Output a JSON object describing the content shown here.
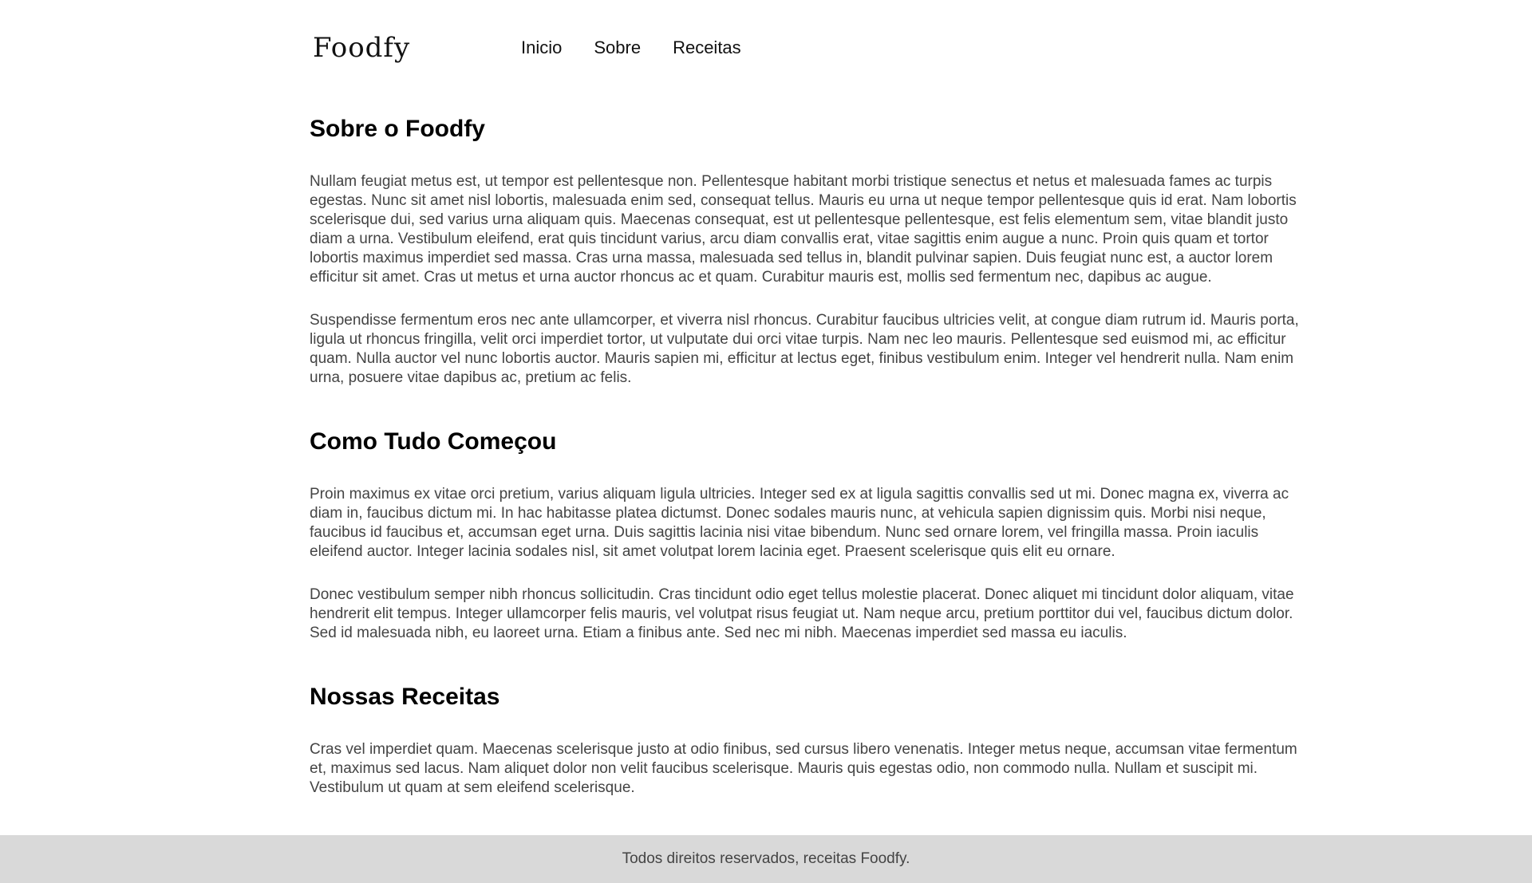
{
  "header": {
    "logo": "Foodfy",
    "nav": [
      "Inicio",
      "Sobre",
      "Receitas"
    ]
  },
  "sections": [
    {
      "title": "Sobre o Foodfy",
      "paragraphs": [
        "Nullam feugiat metus est, ut tempor est pellentesque non. Pellentesque habitant morbi tristique senectus et netus et malesuada fames ac turpis egestas. Nunc sit amet nisl lobortis, malesuada enim sed, consequat tellus. Mauris eu urna ut neque tempor pellentesque quis id erat. Nam lobortis scelerisque dui, sed varius urna aliquam quis. Maecenas consequat, est ut pellentesque pellentesque, est felis elementum sem, vitae blandit justo diam a urna. Vestibulum eleifend, erat quis tincidunt varius, arcu diam convallis erat, vitae sagittis enim augue a nunc. Proin quis quam et tortor lobortis maximus imperdiet sed massa. Cras urna massa, malesuada sed tellus in, blandit pulvinar sapien. Duis feugiat nunc est, a auctor lorem efficitur sit amet. Cras ut metus et urna auctor rhoncus ac et quam. Curabitur mauris est, mollis sed fermentum nec, dapibus ac augue.",
        "Suspendisse fermentum eros nec ante ullamcorper, et viverra nisl rhoncus. Curabitur faucibus ultricies velit, at congue diam rutrum id. Mauris porta, ligula ut rhoncus fringilla, velit orci imperdiet tortor, ut vulputate dui orci vitae turpis. Nam nec leo mauris. Pellentesque sed euismod mi, ac efficitur quam. Nulla auctor vel nunc lobortis auctor. Mauris sapien mi, efficitur at lectus eget, finibus vestibulum enim. Integer vel hendrerit nulla. Nam enim urna, posuere vitae dapibus ac, pretium ac felis."
      ]
    },
    {
      "title": "Como Tudo Começou",
      "paragraphs": [
        "Proin maximus ex vitae orci pretium, varius aliquam ligula ultricies. Integer sed ex at ligula sagittis convallis sed ut mi. Donec magna ex, viverra ac diam in, faucibus dictum mi. In hac habitasse platea dictumst. Donec sodales mauris nunc, at vehicula sapien dignissim quis. Morbi nisi neque, faucibus id faucibus et, accumsan eget urna. Duis sagittis lacinia nisi vitae bibendum. Nunc sed ornare lorem, vel fringilla massa. Proin iaculis eleifend auctor. Integer lacinia sodales nisl, sit amet volutpat lorem lacinia eget. Praesent scelerisque quis elit eu ornare.",
        "Donec vestibulum semper nibh rhoncus sollicitudin. Cras tincidunt odio eget tellus molestie placerat. Donec aliquet mi tincidunt dolor aliquam, vitae hendrerit elit tempus. Integer ullamcorper felis mauris, vel volutpat risus feugiat ut. Nam neque arcu, pretium porttitor dui vel, faucibus dictum dolor. Sed id malesuada nibh, eu laoreet urna. Etiam a finibus ante. Sed nec mi nibh. Maecenas imperdiet sed massa eu iaculis."
      ]
    },
    {
      "title": "Nossas Receitas",
      "paragraphs": [
        "Cras vel imperdiet quam. Maecenas scelerisque justo at odio finibus, sed cursus libero venenatis. Integer metus neque, accumsan vitae fermentum et, maximus sed lacus. Nam aliquet dolor non velit faucibus scelerisque. Mauris quis egestas odio, non commodo nulla. Nullam et suscipit mi. Vestibulum ut quam at sem eleifend scelerisque."
      ]
    }
  ],
  "footer": {
    "text": "Todos direitos reservados, receitas Foodfy."
  }
}
